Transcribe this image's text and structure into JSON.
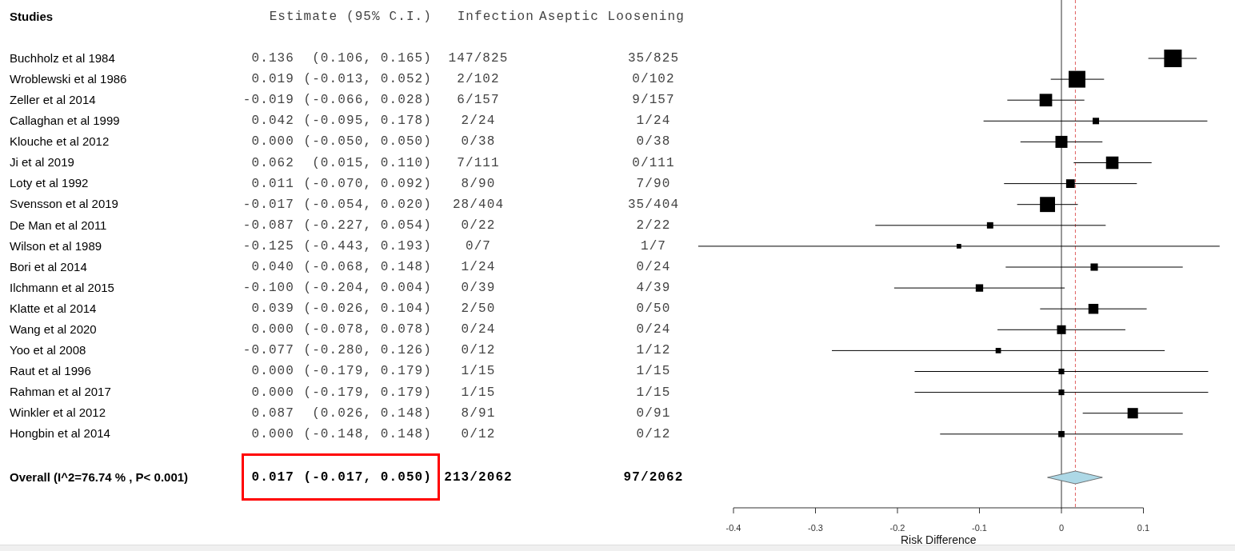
{
  "table": {
    "columns": [
      "Studies",
      "Estimate (95% C.I.)",
      "Infection",
      "Aseptic Loosening"
    ],
    "rows": [
      {
        "study": "Buchholz et al 1984",
        "estimate": "0.136",
        "ci": "(0.106, 0.165)",
        "infection": "147/825",
        "aseptic_loosening": "35/825"
      },
      {
        "study": "Wroblewski et al 1986",
        "estimate": "0.019",
        "ci": "(-0.013, 0.052)",
        "infection": "2/102",
        "aseptic_loosening": "0/102"
      },
      {
        "study": "Zeller et al 2014",
        "estimate": "-0.019",
        "ci": "(-0.066, 0.028)",
        "infection": "6/157",
        "aseptic_loosening": "9/157"
      },
      {
        "study": "Callaghan et al 1999",
        "estimate": "0.042",
        "ci": "(-0.095, 0.178)",
        "infection": "2/24",
        "aseptic_loosening": "1/24"
      },
      {
        "study": "Klouche et al 2012",
        "estimate": "0.000",
        "ci": "(-0.050, 0.050)",
        "infection": "0/38",
        "aseptic_loosening": "0/38"
      },
      {
        "study": "Ji et al 2019",
        "estimate": "0.062",
        "ci": "(0.015, 0.110)",
        "infection": "7/111",
        "aseptic_loosening": "0/111"
      },
      {
        "study": "Loty et al 1992",
        "estimate": "0.011",
        "ci": "(-0.070, 0.092)",
        "infection": "8/90",
        "aseptic_loosening": "7/90"
      },
      {
        "study": "Svensson et al 2019",
        "estimate": "-0.017",
        "ci": "(-0.054, 0.020)",
        "infection": "28/404",
        "aseptic_loosening": "35/404"
      },
      {
        "study": "De Man et al 2011",
        "estimate": "-0.087",
        "ci": "(-0.227, 0.054)",
        "infection": "0/22",
        "aseptic_loosening": "2/22"
      },
      {
        "study": "Wilson et al 1989",
        "estimate": "-0.125",
        "ci": "(-0.443, 0.193)",
        "infection": "0/7",
        "aseptic_loosening": "1/7"
      },
      {
        "study": "Bori et al 2014",
        "estimate": "0.040",
        "ci": "(-0.068, 0.148)",
        "infection": "1/24",
        "aseptic_loosening": "0/24"
      },
      {
        "study": "Ilchmann et al 2015",
        "estimate": "-0.100",
        "ci": "(-0.204, 0.004)",
        "infection": "0/39",
        "aseptic_loosening": "4/39"
      },
      {
        "study": "Klatte et al 2014",
        "estimate": "0.039",
        "ci": "(-0.026, 0.104)",
        "infection": "2/50",
        "aseptic_loosening": "0/50"
      },
      {
        "study": "Wang et al 2020",
        "estimate": "0.000",
        "ci": "(-0.078, 0.078)",
        "infection": "0/24",
        "aseptic_loosening": "0/24"
      },
      {
        "study": "Yoo et al 2008",
        "estimate": "-0.077",
        "ci": "(-0.280, 0.126)",
        "infection": "0/12",
        "aseptic_loosening": "1/12"
      },
      {
        "study": "Raut et al 1996",
        "estimate": "0.000",
        "ci": "(-0.179, 0.179)",
        "infection": "1/15",
        "aseptic_loosening": "1/15"
      },
      {
        "study": "Rahman et al 2017",
        "estimate": "0.000",
        "ci": "(-0.179, 0.179)",
        "infection": "1/15",
        "aseptic_loosening": "1/15"
      },
      {
        "study": "Winkler et al 2012",
        "estimate": "0.087",
        "ci": "(0.026, 0.148)",
        "infection": "8/91",
        "aseptic_loosening": "0/91"
      },
      {
        "study": "Hongbin et al 2014",
        "estimate": "0.000",
        "ci": "(-0.148, 0.148)",
        "infection": "0/12",
        "aseptic_loosening": "0/12"
      }
    ],
    "overall": {
      "study": "Overall (I^2=76.74 % , P< 0.001)",
      "estimate": "0.017",
      "ci": "(-0.017, 0.050)",
      "infection": "213/2062",
      "aseptic_loosening": "97/2062",
      "highlighted": true
    }
  },
  "forest_plot": {
    "xlabel": "Risk Difference",
    "xticks": [
      "-0.4",
      "-0.3",
      "-0.2",
      "-0.1",
      "0",
      "0.1"
    ]
  }
}
